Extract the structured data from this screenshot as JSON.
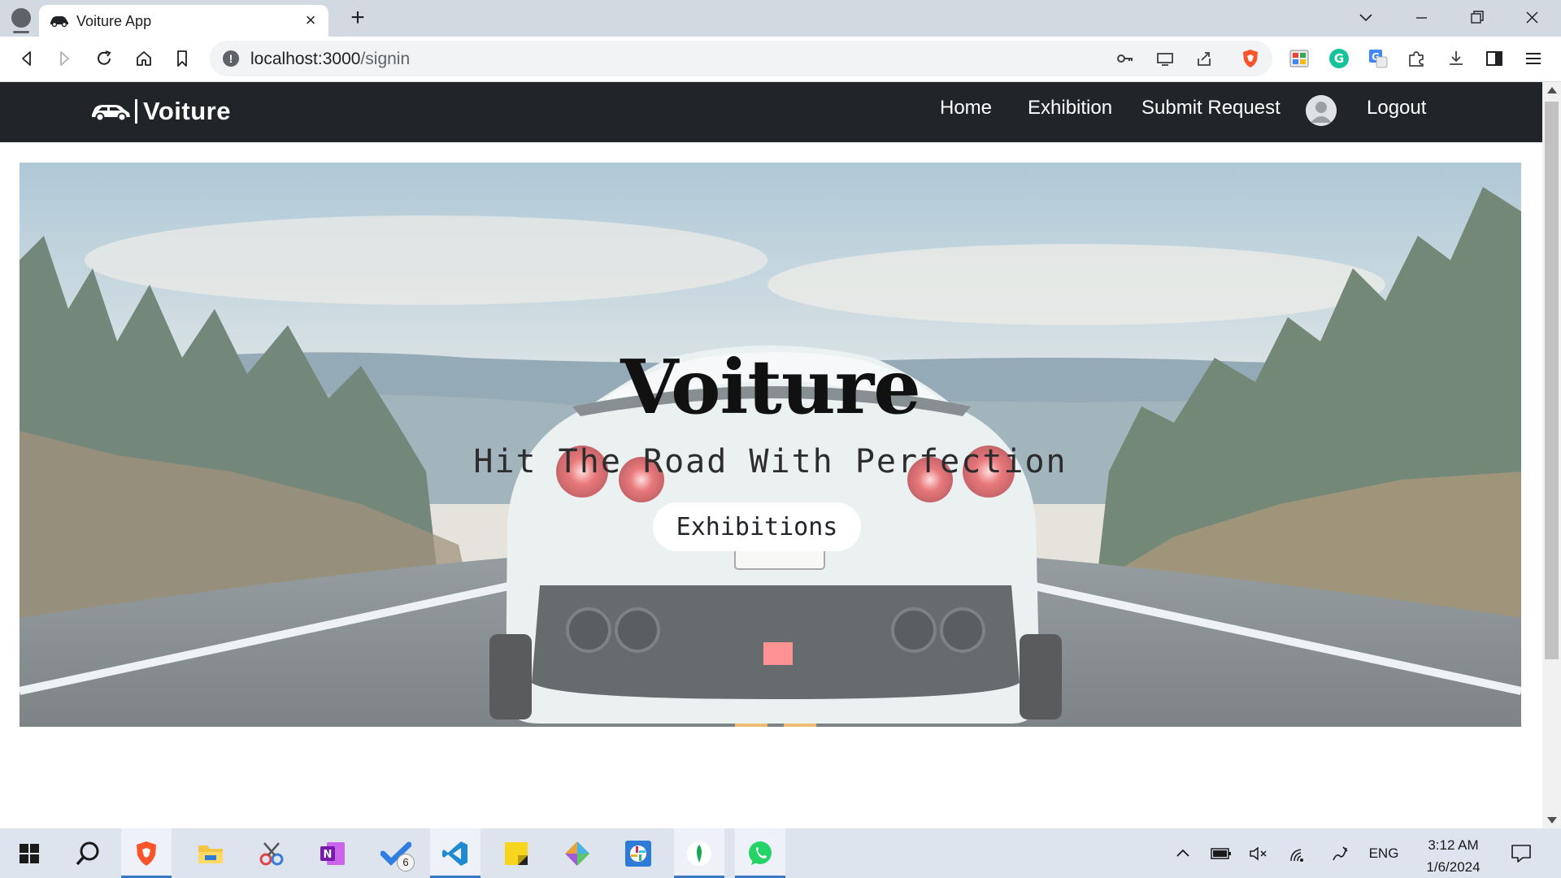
{
  "browser": {
    "tab_title": "Voiture App",
    "url_host": "localhost:3000",
    "url_path": "/signin"
  },
  "site": {
    "brand": "Voiture",
    "nav": {
      "home": "Home",
      "exhibition": "Exhibition",
      "submit_request": "Submit Request",
      "logout": "Logout"
    }
  },
  "hero": {
    "title": "Voiture",
    "subtitle": "Hit The Road With Perfection",
    "button_label": "Exhibitions"
  },
  "taskbar": {
    "todo_badge": "6",
    "language": "ENG",
    "time": "3:12 AM",
    "date": "1/6/2024"
  },
  "colors": {
    "navbar": "#212529",
    "tabstrip": "#d3d9e1",
    "taskbar": "#dde4ee"
  }
}
